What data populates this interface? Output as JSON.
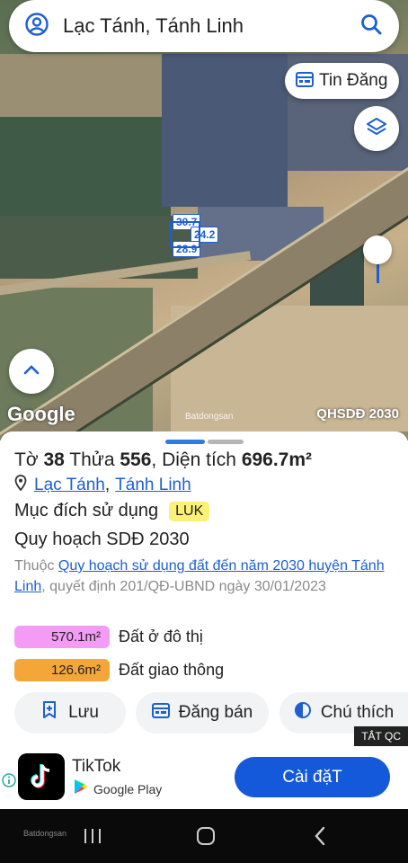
{
  "search": {
    "text": "Lạc Tánh, Tánh Linh"
  },
  "map": {
    "news_button": "Tin Đăng",
    "measures": {
      "top": "30.7",
      "right": "24.2",
      "bottom": "28.9"
    },
    "google_logo": "Google",
    "layer_label": "QHSDĐ 2030",
    "watermark": "Batdongsan"
  },
  "parcel": {
    "sheet_prefix": "Tờ",
    "sheet_no": "38",
    "plot_prefix": "Thửa",
    "plot_no": "556",
    "area_prefix": ", Diện tích",
    "area": "696.7m²",
    "location_a": "Lạc Tánh",
    "location_sep": ",",
    "location_b": "Tánh Linh",
    "purpose_label": "Mục đích sử dụng",
    "purpose_code": "LUK",
    "planning_title": "Quy hoạch SDĐ 2030",
    "belongs_prefix": "Thuộc",
    "plan_link": "Quy hoạch sử dụng đất đến năm 2030 huyện Tánh Linh",
    "decision": ", quyết định 201/QĐ-UBND ngày 30/01/2023",
    "zones": [
      {
        "area": "570.1m²",
        "name": "Đất ở đô thị",
        "color": "#f49cf5"
      },
      {
        "area": "126.6m²",
        "name": "Đất giao thông",
        "color": "#f5a638"
      }
    ]
  },
  "actions": {
    "save": "Lưu",
    "sell": "Đăng bán",
    "legend": "Chú thích"
  },
  "ad": {
    "skip": "TẮT QC",
    "app_name": "TikTok",
    "store": "Google Play",
    "install": "Cài đặT"
  },
  "nav": {
    "brand": "Batdongsan"
  },
  "colors": {
    "accent": "#1e5fd1",
    "install_btn": "#1459d9",
    "luk_badge": "#fbf176"
  }
}
